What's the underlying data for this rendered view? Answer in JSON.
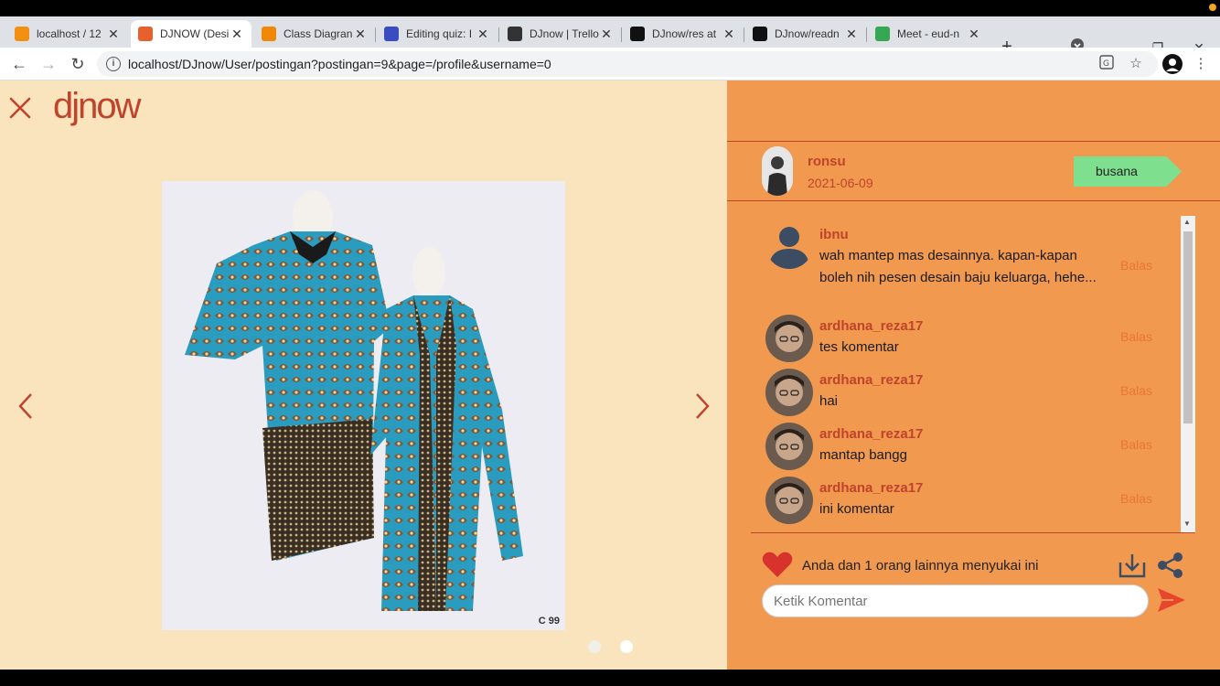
{
  "browser": {
    "tabs": [
      {
        "title": "localhost / 12",
        "favicon_color": "#f29111",
        "active": false
      },
      {
        "title": "DJNOW (Desi",
        "favicon_color": "#e8602c",
        "active": true
      },
      {
        "title": "Class Diagran",
        "favicon_color": "#f08705",
        "active": false
      },
      {
        "title": "Editing quiz: I",
        "favicon_color": "#3b4cc0",
        "active": false
      },
      {
        "title": "DJnow | Trello",
        "favicon_color": "#333333",
        "active": false
      },
      {
        "title": "DJnow/res at",
        "favicon_color": "#111111",
        "active": false
      },
      {
        "title": "DJnow/readn",
        "favicon_color": "#111111",
        "active": false
      },
      {
        "title": "Meet - eud-n",
        "favicon_color": "#34a853",
        "active": false
      }
    ],
    "url": "localhost/DJnow/User/postingan?postingan=9&page=/profile&username=0"
  },
  "page": {
    "logo": "djnow",
    "photo_code": "C 99",
    "carousel": {
      "slides": 2,
      "active_index": 1
    },
    "post": {
      "username": "ronsu",
      "date": "2021-06-09",
      "category": "busana"
    },
    "comments": [
      {
        "user": "ibnu",
        "text": "wah mantep mas desainnya. kapan-kapan boleh nih pesen desain baju keluarga, hehe...",
        "reply_label": "Balas",
        "avatar": "default"
      },
      {
        "user": "ardhana_reza17",
        "text": "tes komentar",
        "reply_label": "Balas",
        "avatar": "photo"
      },
      {
        "user": "ardhana_reza17",
        "text": "hai",
        "reply_label": "Balas",
        "avatar": "photo"
      },
      {
        "user": "ardhana_reza17",
        "text": "mantap bangg",
        "reply_label": "Balas",
        "avatar": "photo"
      },
      {
        "user": "ardhana_reza17",
        "text": "ini komentar",
        "reply_label": "Balas",
        "avatar": "photo"
      }
    ],
    "likes_text": "Anda dan 1 orang lainnya menyukai ini",
    "comment_placeholder": "Ketik Komentar"
  },
  "colors": {
    "accent": "#c0432b",
    "panel": "#f0994f",
    "left_bg": "#f9e4be",
    "tag": "#7ee08e"
  }
}
